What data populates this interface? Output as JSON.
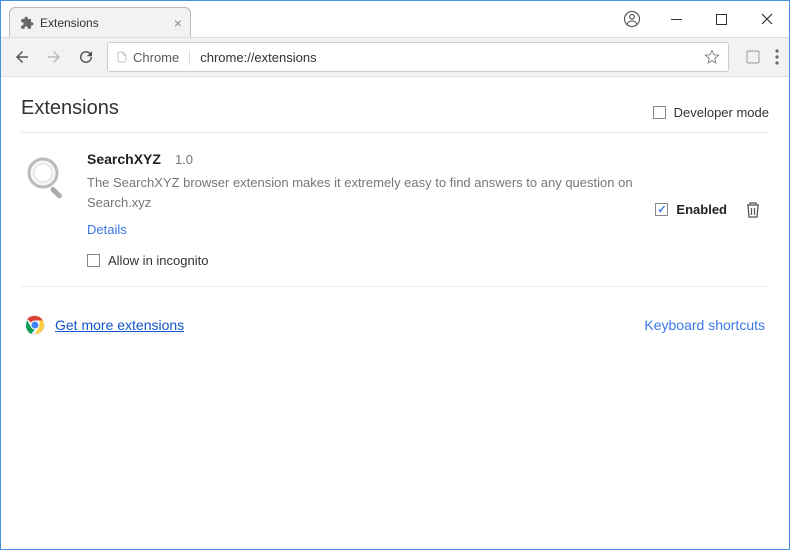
{
  "tab": {
    "title": "Extensions"
  },
  "omnibox": {
    "label": "Chrome",
    "url": "chrome://extensions"
  },
  "page": {
    "title": "Extensions"
  },
  "devmode": {
    "label": "Developer mode",
    "checked": false
  },
  "extension": {
    "name": "SearchXYZ",
    "version": "1.0",
    "description": "The SearchXYZ browser extension makes it extremely easy to find answers to any question on Search.xyz",
    "details_label": "Details",
    "incognito_label": "Allow in incognito",
    "incognito_checked": false,
    "enabled_label": "Enabled",
    "enabled": true
  },
  "footer": {
    "get_more": "Get more extensions",
    "shortcuts": "Keyboard shortcuts"
  }
}
